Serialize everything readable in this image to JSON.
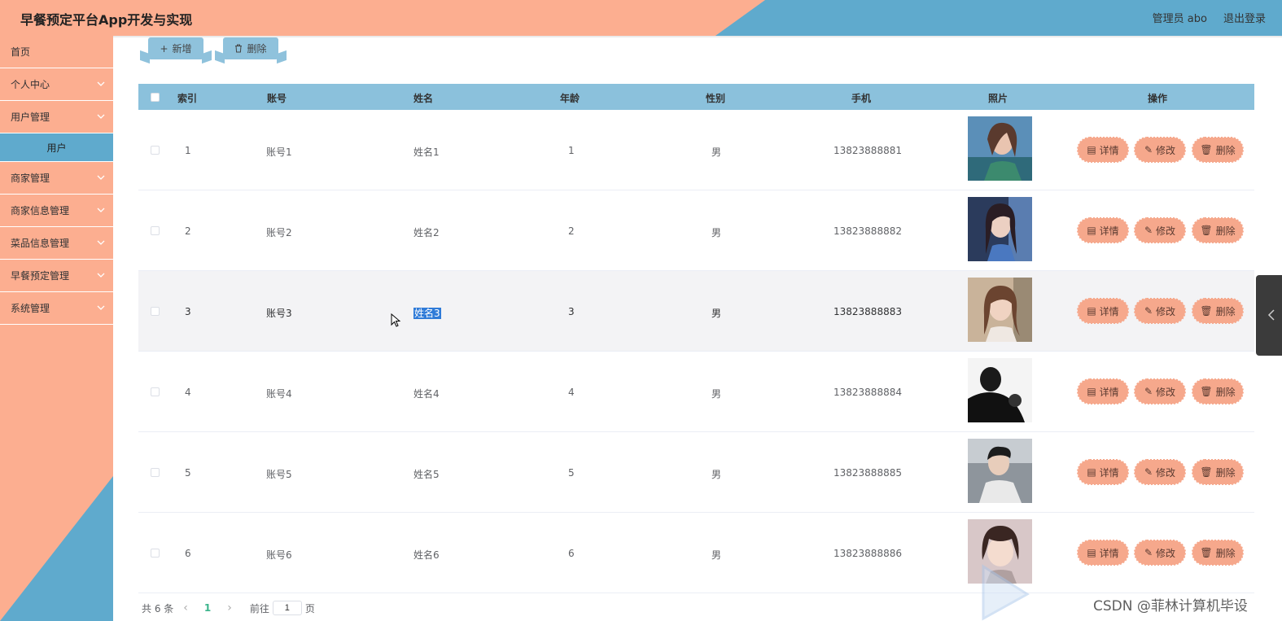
{
  "header": {
    "title": "早餐预定平台App开发与实现",
    "user_label": "管理员 abo",
    "logout_label": "退出登录",
    "accent_peach": "#fcae90",
    "accent_blue": "#5faacd"
  },
  "sidebar": {
    "items": [
      {
        "label": "首页",
        "icon": "none"
      },
      {
        "label": "个人中心",
        "icon": "chevron-down-icon"
      },
      {
        "label": "用户管理",
        "icon": "chevron-down-icon"
      },
      {
        "label": "用户",
        "icon": "none"
      },
      {
        "label": "商家管理",
        "icon": "chevron-down-icon"
      },
      {
        "label": "商家信息管理",
        "icon": "chevron-down-icon"
      },
      {
        "label": "菜品信息管理",
        "icon": "chevron-down-icon"
      },
      {
        "label": "早餐预定管理",
        "icon": "chevron-down-icon"
      },
      {
        "label": "系统管理",
        "icon": "chevron-down-icon"
      }
    ]
  },
  "toolbar": {
    "add_label": "新增",
    "delete_label": "删除"
  },
  "table": {
    "columns": [
      "索引",
      "账号",
      "姓名",
      "年龄",
      "性别",
      "手机",
      "照片",
      "操作"
    ],
    "rows": [
      {
        "index": "1",
        "account": "账号1",
        "name": "姓名1",
        "age": "1",
        "gender": "男",
        "phone": "13823888881"
      },
      {
        "index": "2",
        "account": "账号2",
        "name": "姓名2",
        "age": "2",
        "gender": "男",
        "phone": "13823888882"
      },
      {
        "index": "3",
        "account": "账号3",
        "name": "姓名3",
        "age": "3",
        "gender": "男",
        "phone": "13823888883"
      },
      {
        "index": "4",
        "account": "账号4",
        "name": "姓名4",
        "age": "4",
        "gender": "男",
        "phone": "13823888884"
      },
      {
        "index": "5",
        "account": "账号5",
        "name": "姓名5",
        "age": "5",
        "gender": "男",
        "phone": "13823888885"
      },
      {
        "index": "6",
        "account": "账号6",
        "name": "姓名6",
        "age": "6",
        "gender": "男",
        "phone": "13823888886"
      }
    ],
    "actions": {
      "detail": "详情",
      "edit": "修改",
      "delete": "删除"
    }
  },
  "pagination": {
    "total_label": "共 6 条",
    "current_page": "1",
    "goto_label": "前往",
    "page_input_value": "1",
    "page_suffix": "页"
  },
  "watermark": "CSDN @菲林计算机毕设"
}
